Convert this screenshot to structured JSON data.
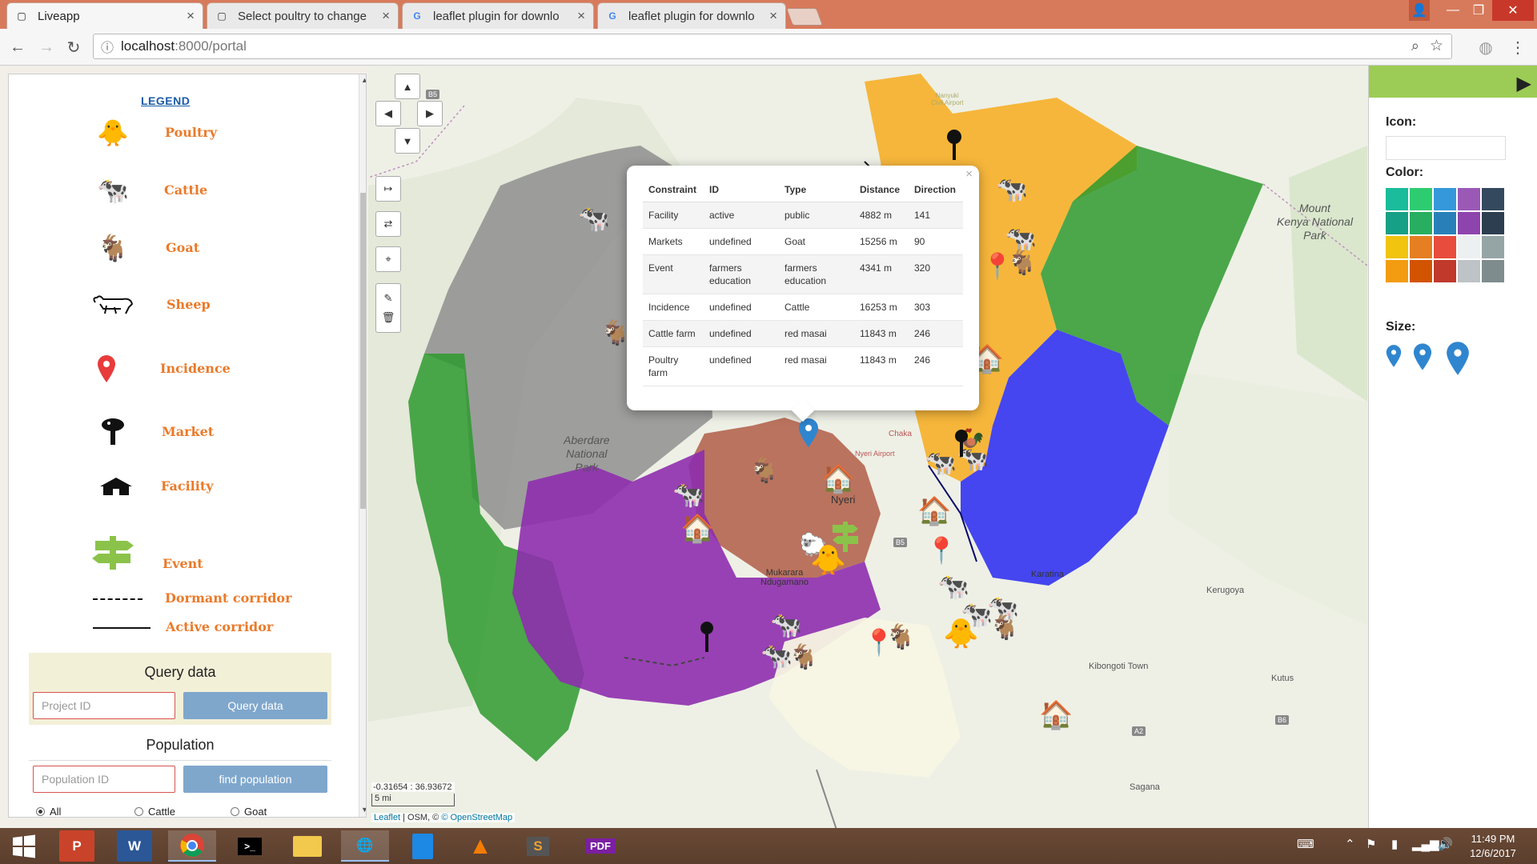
{
  "browser": {
    "tabs": [
      {
        "title": "Liveapp",
        "icon": "page-icon",
        "active": true
      },
      {
        "title": "Select poultry to change",
        "icon": "page-icon",
        "active": false
      },
      {
        "title": "leaflet plugin for downlo",
        "icon": "google-icon",
        "active": false
      },
      {
        "title": "leaflet plugin for downlo",
        "icon": "google-icon",
        "active": false
      }
    ],
    "address": {
      "host": "localhost",
      "path": ":8000/portal"
    }
  },
  "legend": {
    "title": "LEGEND",
    "items": [
      {
        "label": "Poultry",
        "icon": "chicken-icon"
      },
      {
        "label": "Cattle",
        "icon": "cow-icon"
      },
      {
        "label": "Goat",
        "icon": "goat-icon"
      },
      {
        "label": "Sheep",
        "icon": "sheep-icon"
      },
      {
        "label": "Incidence",
        "icon": "red-pin-icon"
      },
      {
        "label": "Market",
        "icon": "black-pin-icon"
      },
      {
        "label": "Facility",
        "icon": "house-icon"
      },
      {
        "label": "Event",
        "icon": "signpost-icon"
      },
      {
        "label": "Dormant corridor",
        "icon": "dashed-line"
      },
      {
        "label": "Active corridor",
        "icon": "solid-line"
      }
    ]
  },
  "query": {
    "title": "Query data",
    "input_placeholder": "Project ID",
    "button": "Query data"
  },
  "population": {
    "title": "Population",
    "input_placeholder": "Population ID",
    "button": "find population",
    "options": [
      {
        "label": "All",
        "checked": true
      },
      {
        "label": "Cattle",
        "checked": false
      },
      {
        "label": "Goat",
        "checked": false
      }
    ]
  },
  "map": {
    "labels": {
      "aberdare": "Aberdare\nNational\nPark",
      "mtkenya": "Mount\nKenya National\nPark",
      "nyeri": "Nyeri",
      "mukarara": "Mukarara\nNdugamano",
      "karatina": "Karatina",
      "kerugoya": "Kerugoya",
      "kibongoti": "Kibongoti Town",
      "kutus": "Kutus",
      "sagana": "Sagana",
      "chaka": "Chaka",
      "nyeri_airport": "Nyeri Airport",
      "nanyuki": "Nanyuki\nCivil Airport",
      "b5_top": "B5",
      "b5_mid": "B5",
      "a2": "A2",
      "b6": "B6"
    },
    "coordinates": "-0.31654 : 36.93672",
    "scale": "5 mi",
    "attribution": {
      "leaflet": "Leaflet",
      "osm": "| OSM, ©",
      "osm_link": "© OpenStreetMap"
    }
  },
  "popup": {
    "headers": [
      "Constraint",
      "ID",
      "Type",
      "Distance",
      "Direction"
    ],
    "rows": [
      [
        "Facility",
        "active",
        "public",
        "4882 m",
        "141"
      ],
      [
        "Markets",
        "undefined",
        "Goat",
        "15256 m",
        "90"
      ],
      [
        "Event",
        "farmers education",
        "farmers education",
        "4341 m",
        "320"
      ],
      [
        "Incidence",
        "undefined",
        "Cattle",
        "16253 m",
        "303"
      ],
      [
        "Cattle farm",
        "undefined",
        "red masai",
        "11843 m",
        "246"
      ],
      [
        "Poultry farm",
        "undefined",
        "red masai",
        "11843 m",
        "246"
      ]
    ]
  },
  "style_panel": {
    "icon_label": "Icon:",
    "color_label": "Color:",
    "size_label": "Size:",
    "colors": [
      "#1abc9c",
      "#2ecc71",
      "#3498db",
      "#9b59b6",
      "#34495e",
      "#16a085",
      "#27ae60",
      "#2980b9",
      "#8e44ad",
      "#2c3e50",
      "#f1c40f",
      "#e67e22",
      "#e74c3c",
      "#ecf0f1",
      "#95a5a6",
      "#f39c12",
      "#d35400",
      "#c0392b",
      "#bdc3c7",
      "#7f8c8d"
    ]
  },
  "taskbar": {
    "time": "11:49 PM",
    "date": "12/6/2017"
  }
}
